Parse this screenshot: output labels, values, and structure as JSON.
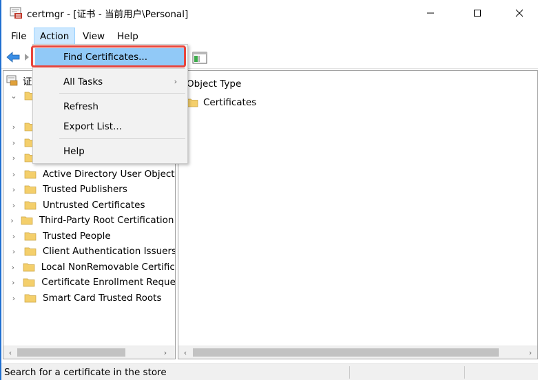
{
  "window": {
    "title": "certmgr - [证书 - 当前用户\\Personal]"
  },
  "menubar": {
    "file": "File",
    "action": "Action",
    "view": "View",
    "help": "Help"
  },
  "action_menu": {
    "items": [
      {
        "label": "Find Certificates...",
        "highlighted": true
      },
      {
        "label": "All Tasks",
        "has_submenu": true
      },
      {
        "label": "Refresh"
      },
      {
        "label": "Export List..."
      },
      {
        "label": "Help"
      }
    ]
  },
  "tree": {
    "root_label": "证",
    "items": [
      {
        "label": "Active Directory User Object"
      },
      {
        "label": "Trusted Publishers"
      },
      {
        "label": "Untrusted Certificates"
      },
      {
        "label": "Third-Party Root Certification Authorities"
      },
      {
        "label": "Trusted People"
      },
      {
        "label": "Client Authentication Issuers"
      },
      {
        "label": "Local NonRemovable Certificates"
      },
      {
        "label": "Certificate Enrollment Requests"
      },
      {
        "label": "Smart Card Trusted Roots"
      }
    ]
  },
  "list": {
    "column_header": "Object Type",
    "rows": [
      {
        "label": "Certificates"
      }
    ]
  },
  "status": {
    "text": "Search for a certificate in the store"
  },
  "colors": {
    "accent": "#1f6fd0",
    "menu_highlight": "#91c9f7",
    "annotation_red": "#e8453c",
    "folder_yellow": "#f4cf6b"
  }
}
